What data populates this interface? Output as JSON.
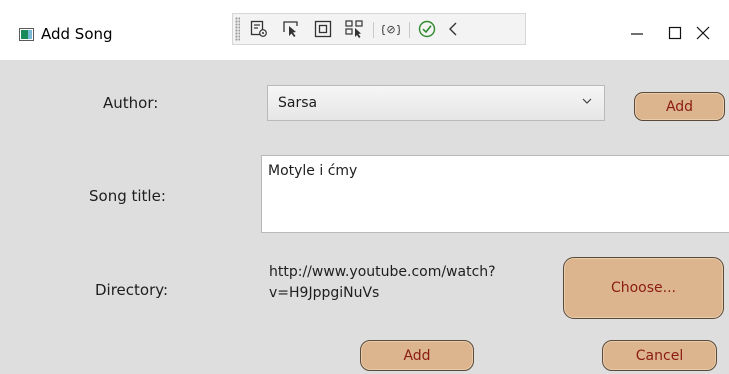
{
  "window": {
    "title": "Add Song",
    "controls": {
      "minimize": "–",
      "maximize": "☐",
      "close": "✕"
    }
  },
  "debug_toolbar": {
    "tools": [
      {
        "name": "live-visual-tree",
        "icon": "live-tree-icon"
      },
      {
        "name": "select-element",
        "icon": "select-element-icon"
      },
      {
        "name": "display-layout-adorners",
        "icon": "layout-adorner-icon"
      },
      {
        "name": "track-focused-element",
        "icon": "track-focus-icon"
      },
      {
        "name": "binding-failures",
        "icon": "binding-icon"
      },
      {
        "name": "hot-reload-status",
        "icon": "checkmark-icon"
      },
      {
        "name": "collapse-toolbar",
        "icon": "chevron-left-icon"
      }
    ]
  },
  "form": {
    "author": {
      "label": "Author:",
      "selected": "Sarsa"
    },
    "author_add_button": "Add",
    "song_title": {
      "label": "Song title:",
      "value": "Motyle i ćmy"
    },
    "directory": {
      "label": "Directory:",
      "value": "http://www.youtube.com/watch?\nv=H9JppgiNuVs"
    },
    "choose_button": "Choose...",
    "add_button": "Add",
    "cancel_button": "Cancel"
  },
  "colors": {
    "button_fill": "#dcb58e",
    "button_text": "#8a1c10",
    "window_bg": "#dedede"
  }
}
